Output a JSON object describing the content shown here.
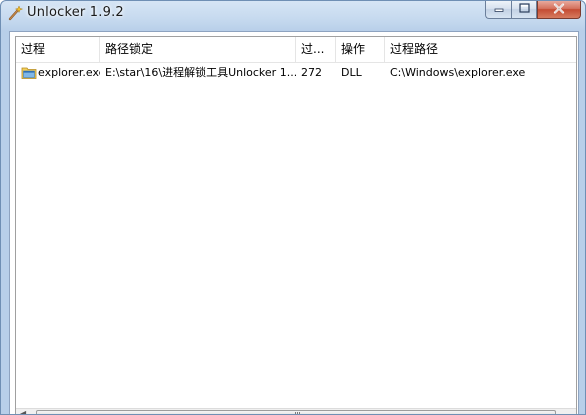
{
  "window": {
    "title": "Unlocker 1.9.2",
    "icon": "wand-icon"
  },
  "list": {
    "columns": [
      "过程",
      "路径锁定",
      "过...",
      "操作",
      "过程路径"
    ],
    "rows": [
      {
        "icon": "folder-app-icon",
        "process": "explorer.exe",
        "locked_path": "E:\\star\\16\\进程解锁工具Unlocker 1...",
        "pid": "272",
        "type": "DLL",
        "process_path": "C:\\Windows\\explorer.exe"
      }
    ]
  },
  "colors": {
    "title_bg": "#c4d8ee",
    "close_button": "#c44b32",
    "border": "#6f8fb4"
  }
}
